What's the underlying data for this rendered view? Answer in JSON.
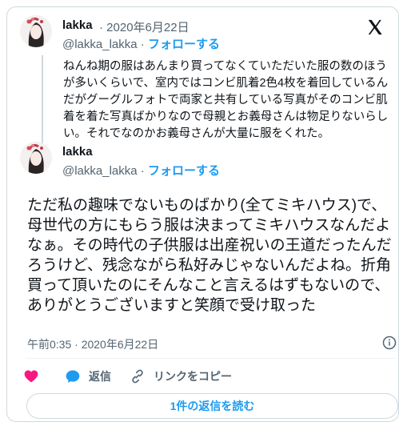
{
  "quoted_tweet": {
    "name": "lakka",
    "separator": "·",
    "date": "2020年6月22日",
    "handle": "@lakka_lakka",
    "follow": "フォローする",
    "text": "ねんね期の服はあんまり買ってなくていただいた服の数のほうが多いくらいで、室内ではコンビ肌着2色4枚を着回しているんだがグーグルフォトで両家と共有している写真がそのコンビ肌着を着た写真ばかりなので母親とお義母さんは物足りないらしい。それでなのかお義母さんが大量に服をくれた。"
  },
  "main_tweet": {
    "name": "lakka",
    "handle": "@lakka_lakka",
    "follow": "フォローする",
    "text": "ただ私の趣味でないものばかり(全てミキハウス)で、母世代の方にもらう服は決まってミキハウスなんだよなぁ。その時代の子供服は出産祝いの王道だったんだろうけど、残念ながら私好みじゃないんだよね。折角買って頂いたのにそんなこと言えるはずもないので、ありがとうございますと笑顔で受け取った",
    "timestamp": "午前0:35 · 2020年6月22日"
  },
  "actions": {
    "like_icon": "heart-icon",
    "reply_label": "返信",
    "copy_link_label": "リンクをコピー",
    "read_replies": "1件の返信を読む"
  },
  "colors": {
    "accent": "#1d9bf0",
    "like": "#f91880",
    "muted": "#536471",
    "border": "#cfd9de"
  }
}
